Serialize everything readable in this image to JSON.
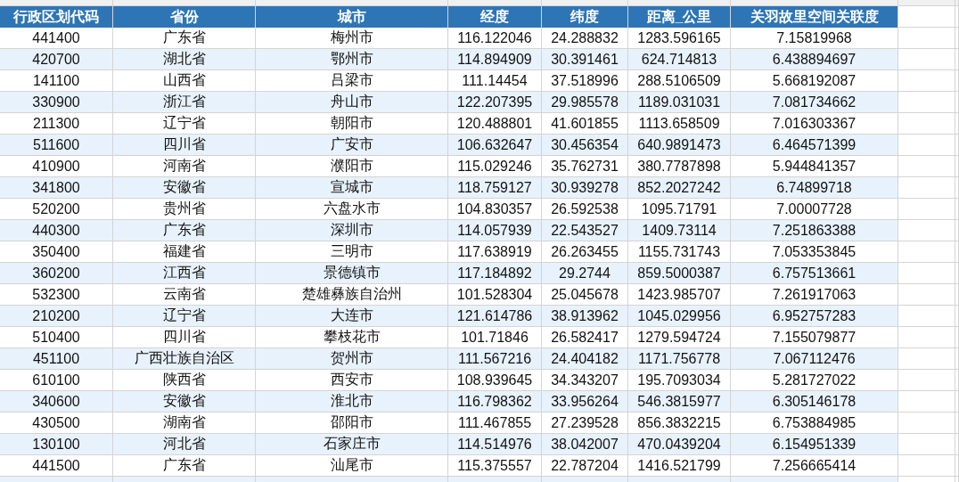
{
  "table": {
    "columns": [
      "行政区划代码",
      "省份",
      "城市",
      "经度",
      "纬度",
      "距离_公里",
      "关羽故里空间关联度"
    ],
    "rows": [
      [
        "441400",
        "广东省",
        "梅州市",
        "116.122046",
        "24.288832",
        "1283.596165",
        "7.15819968"
      ],
      [
        "420700",
        "湖北省",
        "鄂州市",
        "114.894909",
        "30.391461",
        "624.714813",
        "6.438894697"
      ],
      [
        "141100",
        "山西省",
        "吕梁市",
        "111.14454",
        "37.518996",
        "288.5106509",
        "5.668192087"
      ],
      [
        "330900",
        "浙江省",
        "舟山市",
        "122.207395",
        "29.985578",
        "1189.031031",
        "7.081734662"
      ],
      [
        "211300",
        "辽宁省",
        "朝阳市",
        "120.488801",
        "41.601855",
        "1113.658509",
        "7.016303367"
      ],
      [
        "511600",
        "四川省",
        "广安市",
        "106.632647",
        "30.456354",
        "640.9891473",
        "6.464571399"
      ],
      [
        "410900",
        "河南省",
        "濮阳市",
        "115.029246",
        "35.762731",
        "380.7787898",
        "5.944841357"
      ],
      [
        "341800",
        "安徽省",
        "宣城市",
        "118.759127",
        "30.939278",
        "852.2027242",
        "6.74899718"
      ],
      [
        "520200",
        "贵州省",
        "六盘水市",
        "104.830357",
        "26.592538",
        "1095.71791",
        "7.00007728"
      ],
      [
        "440300",
        "广东省",
        "深圳市",
        "114.057939",
        "22.543527",
        "1409.73114",
        "7.251863388"
      ],
      [
        "350400",
        "福建省",
        "三明市",
        "117.638919",
        "26.263455",
        "1155.731743",
        "7.053353845"
      ],
      [
        "360200",
        "江西省",
        "景德镇市",
        "117.184892",
        "29.2744",
        "859.5000387",
        "6.757513661"
      ],
      [
        "532300",
        "云南省",
        "楚雄彝族自治州",
        "101.528304",
        "25.045678",
        "1423.985707",
        "7.261917063"
      ],
      [
        "210200",
        "辽宁省",
        "大连市",
        "121.614786",
        "38.913962",
        "1045.029956",
        "6.952757283"
      ],
      [
        "510400",
        "四川省",
        "攀枝花市",
        "101.71846",
        "26.582417",
        "1279.594724",
        "7.155079877"
      ],
      [
        "451100",
        "广西壮族自治区",
        "贺州市",
        "111.567216",
        "24.404182",
        "1171.756778",
        "7.067112476"
      ],
      [
        "610100",
        "陕西省",
        "西安市",
        "108.939645",
        "34.343207",
        "195.7093034",
        "5.281727022"
      ],
      [
        "340600",
        "安徽省",
        "淮北市",
        "116.798362",
        "33.956264",
        "546.3815977",
        "6.305146178"
      ],
      [
        "430500",
        "湖南省",
        "邵阳市",
        "111.467855",
        "27.239528",
        "856.3832215",
        "6.753884985"
      ],
      [
        "130100",
        "河北省",
        "石家庄市",
        "114.514976",
        "38.042007",
        "470.0439204",
        "6.154951339"
      ],
      [
        "441500",
        "广东省",
        "汕尾市",
        "115.375557",
        "22.787204",
        "1416.521799",
        "7.256665414"
      ]
    ]
  }
}
